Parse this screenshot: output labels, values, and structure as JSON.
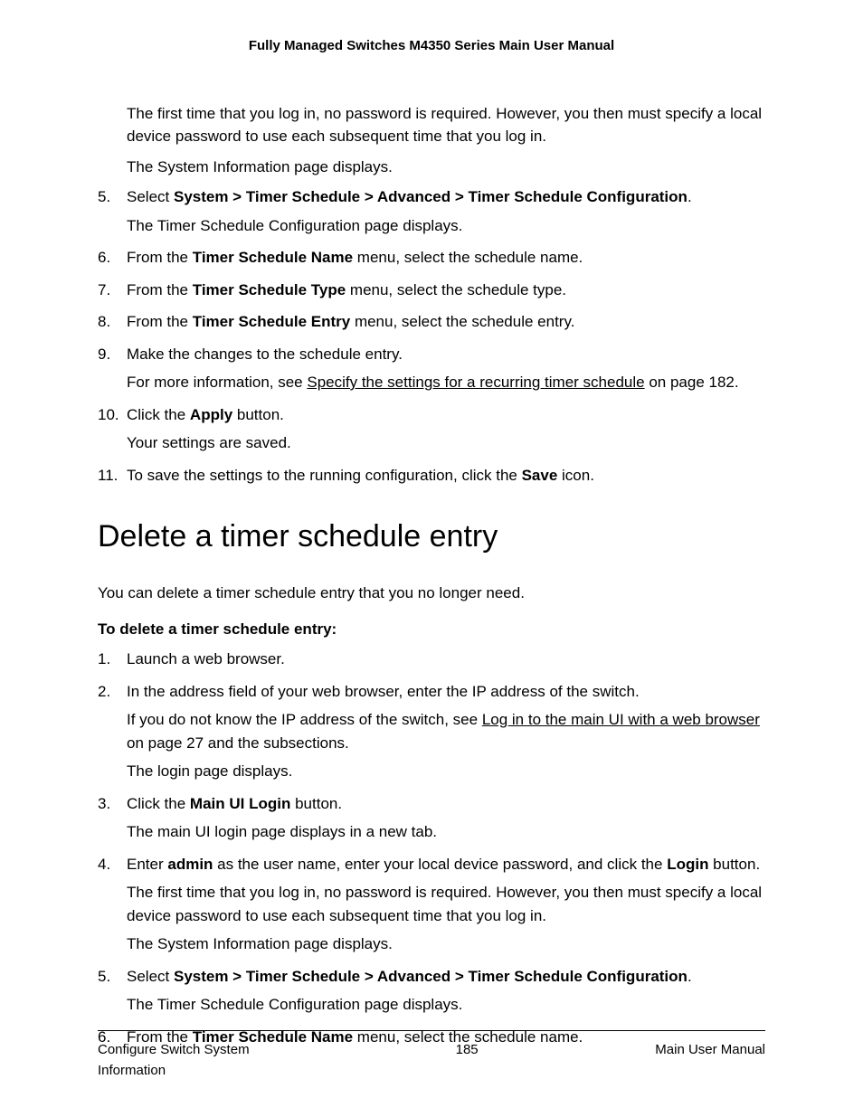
{
  "header": "Fully Managed Switches M4350 Series Main User Manual",
  "top_block": {
    "p1": "The first time that you log in, no password is required. However, you then must specify a local device password to use each subsequent time that you log in.",
    "p2": "The System Information page displays."
  },
  "stepsA": {
    "s5": {
      "num": "5.",
      "pre": "Select ",
      "bold": "System > Timer Schedule > Advanced > Timer Schedule Configuration",
      "post": ".",
      "sub": "The Timer Schedule Configuration page displays."
    },
    "s6": {
      "num": "6.",
      "pre": "From the ",
      "bold": "Timer Schedule Name",
      "post": " menu, select the schedule name."
    },
    "s7": {
      "num": "7.",
      "pre": "From the ",
      "bold": "Timer Schedule Type",
      "post": " menu, select the schedule type."
    },
    "s8": {
      "num": "8.",
      "pre": "From the ",
      "bold": "Timer Schedule Entry",
      "post": " menu, select the schedule entry."
    },
    "s9": {
      "num": "9.",
      "main": "Make the changes to the schedule entry.",
      "sub_pre": "For more information, see ",
      "sub_link": "Specify the settings for a recurring timer schedule",
      "sub_post": " on page 182."
    },
    "s10": {
      "num": "10.",
      "pre": "Click the ",
      "bold": "Apply",
      "post": " button.",
      "sub": "Your settings are saved."
    },
    "s11": {
      "num": "11.",
      "pre": "To save the settings to the running configuration, click the ",
      "bold": "Save",
      "post": " icon."
    }
  },
  "section_heading": "Delete a timer schedule entry",
  "intro": "You can delete a timer schedule entry that you no longer need.",
  "procedure_title": "To delete a timer schedule entry:",
  "stepsB": {
    "s1": {
      "num": "1.",
      "main": "Launch a web browser."
    },
    "s2": {
      "num": "2.",
      "main": "In the address field of your web browser, enter the IP address of the switch.",
      "sub1_pre": "If you do not know the IP address of the switch, see ",
      "sub1_link": "Log in to the main UI with a web browser",
      "sub1_post": " on page 27 and the subsections.",
      "sub2": "The login page displays."
    },
    "s3": {
      "num": "3.",
      "pre": "Click the ",
      "bold": "Main UI Login",
      "post": " button.",
      "sub": "The main UI login page displays in a new tab."
    },
    "s4": {
      "num": "4.",
      "pre": "Enter ",
      "bold1": "admin",
      "mid": " as the user name, enter your local device password, and click the ",
      "bold2": "Login",
      "post": " button.",
      "sub1": "The first time that you log in, no password is required. However, you then must specify a local device password to use each subsequent time that you log in.",
      "sub2": "The System Information page displays."
    },
    "s5": {
      "num": "5.",
      "pre": "Select ",
      "bold": "System > Timer Schedule > Advanced > Timer Schedule Configuration",
      "post": ".",
      "sub": "The Timer Schedule Configuration page displays."
    },
    "s6": {
      "num": "6.",
      "pre": "From the ",
      "bold": "Timer Schedule Name",
      "post": " menu, select the schedule name."
    }
  },
  "footer": {
    "left": "Configure Switch System Information",
    "center": "185",
    "right": "Main User Manual"
  }
}
